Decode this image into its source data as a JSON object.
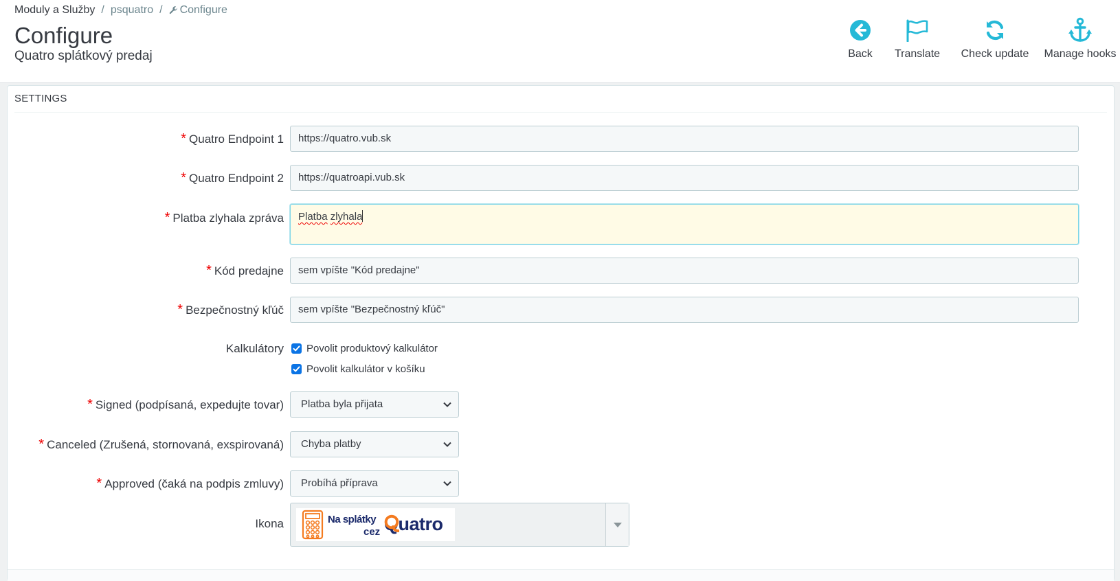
{
  "breadcrumb": {
    "item1": "Moduly a Služby",
    "item2": "psquatro",
    "item3": "Configure"
  },
  "page": {
    "title": "Configure",
    "subtitle": "Quatro splátkový predaj"
  },
  "toolbar": {
    "back": "Back",
    "translate": "Translate",
    "check_update": "Check update",
    "manage_hooks": "Manage hooks"
  },
  "colors": {
    "accent": "#25b9d7",
    "required": "#e00000",
    "checkbox": "#0b74e5",
    "logo_orange": "#f47b20",
    "logo_navy": "#1b2a6b"
  },
  "panel": {
    "heading": "SETTINGS"
  },
  "form": {
    "required_mark": "*",
    "endpoint1": {
      "label": "Quatro Endpoint 1",
      "value": "https://quatro.vub.sk"
    },
    "endpoint2": {
      "label": "Quatro Endpoint 2",
      "value": "https://quatroapi.vub.sk"
    },
    "fail_message": {
      "label": "Platba zlyhala zpráva",
      "value_word1": "Platba",
      "value_word2": "zlyhala"
    },
    "shop_code": {
      "label": "Kód predajne",
      "value": "sem vpíšte \"Kód predajne\""
    },
    "security_key": {
      "label": "Bezpečnostný kľúč",
      "value": "sem vpíšte \"Bezpečnostný kľúč\""
    },
    "calculators": {
      "label": "Kalkulátory",
      "product": {
        "label": "Povolit produktový kalkulátor",
        "checked": true
      },
      "cart": {
        "label": "Povolit kalkulátor v košíku",
        "checked": true
      }
    },
    "signed": {
      "label": "Signed (podpísaná, expedujte tovar)",
      "selected": "Platba byla přijata"
    },
    "canceled": {
      "label": "Canceled (Zrušená, stornovaná, exspirovaná)",
      "selected": "Chyba platby"
    },
    "approved": {
      "label": "Approved (čaká na podpis zmluvy)",
      "selected": "Probíhá příprava"
    },
    "icon": {
      "label": "Ikona",
      "logo_line1": "Na splátky",
      "logo_line2": "cez",
      "logo_brand": "Quatro"
    }
  }
}
